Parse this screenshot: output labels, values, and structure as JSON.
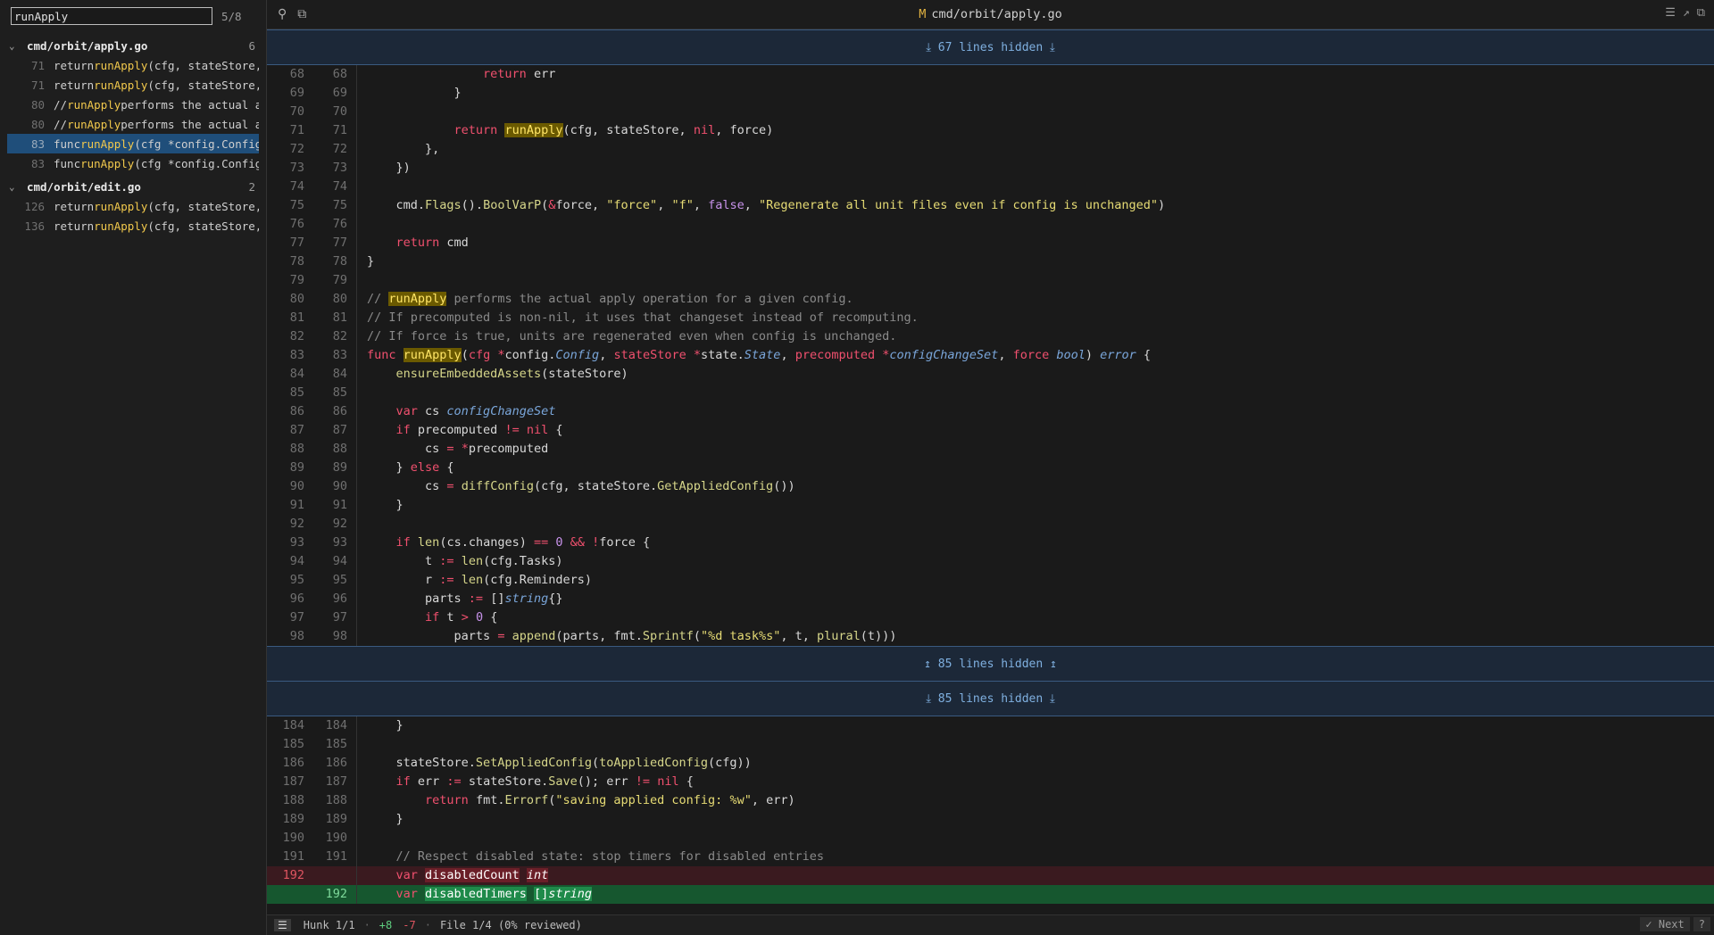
{
  "search": {
    "value": "runApply",
    "match_count": "5/8"
  },
  "results": [
    {
      "file": "cmd/orbit/apply.go",
      "count": "6",
      "matches": [
        {
          "line": "71",
          "pre": "return ",
          "hl": "runApply",
          "post": "(cfg, stateStore, ni",
          "selected": false
        },
        {
          "line": "71",
          "pre": "return ",
          "hl": "runApply",
          "post": "(cfg, stateStore, ni",
          "selected": false
        },
        {
          "line": "80",
          "pre": "// ",
          "hl": "runApply",
          "post": " performs the actual app",
          "selected": false
        },
        {
          "line": "80",
          "pre": "// ",
          "hl": "runApply",
          "post": " performs the actual app",
          "selected": false
        },
        {
          "line": "83",
          "pre": "func ",
          "hl": "runApply",
          "post": "(cfg *config.Config, s",
          "selected": true
        },
        {
          "line": "83",
          "pre": "func ",
          "hl": "runApply",
          "post": "(cfg *config.Config, s",
          "selected": false
        }
      ]
    },
    {
      "file": "cmd/orbit/edit.go",
      "count": "2",
      "matches": [
        {
          "line": "126",
          "pre": "return ",
          "hl": "runApply",
          "post": "(cfg, stateStore, &c",
          "selected": false
        },
        {
          "line": "136",
          "pre": "return ",
          "hl": "runApply",
          "post": "(cfg, stateStore, &c",
          "selected": false
        }
      ]
    }
  ],
  "topbar": {
    "status_mark": "M",
    "file_title": "cmd/orbit/apply.go"
  },
  "hidden": {
    "top": "⤓ 67 lines hidden ⤓",
    "mid_up": "↥ 85 lines hidden ↥",
    "mid_down": "⤓ 85 lines hidden ⤓"
  },
  "code_top": [
    {
      "o": "68",
      "n": "68",
      "html": "            <span class='k'>return</span> err"
    },
    {
      "o": "69",
      "n": "69",
      "html": "        }"
    },
    {
      "o": "70",
      "n": "70",
      "html": ""
    },
    {
      "o": "71",
      "n": "71",
      "html": "        <span class='k'>return</span> <span class='hlw'>runApply</span>(cfg, stateStore, <span class='k'>nil</span>, force)"
    },
    {
      "o": "72",
      "n": "72",
      "html": "    },"
    },
    {
      "o": "73",
      "n": "73",
      "html": "})"
    },
    {
      "o": "74",
      "n": "74",
      "html": ""
    },
    {
      "o": "75",
      "n": "75",
      "html": "cmd.<span class='f'>Flags</span>().<span class='f'>BoolVarP</span>(<span class='pu'>&amp;</span>force, <span class='s'>\"force\"</span>, <span class='s'>\"f\"</span>, <span class='nm'>false</span>, <span class='s'>\"Regenerate all unit files even if config is unchanged\"</span>)"
    },
    {
      "o": "76",
      "n": "76",
      "html": ""
    },
    {
      "o": "77",
      "n": "77",
      "html": "<span class='k'>return</span> cmd"
    },
    {
      "o": "78",
      "n": "78",
      "html": "}",
      "outdent": true
    },
    {
      "o": "79",
      "n": "79",
      "html": ""
    },
    {
      "o": "80",
      "n": "80",
      "html": "<span class='c'>// </span><span class='hlw'>runApply</span><span class='c'> performs the actual apply operation for a given config.</span>",
      "outdent": true
    },
    {
      "o": "81",
      "n": "81",
      "html": "<span class='c'>// If precomputed is non-nil, it uses that changeset instead of recomputing.</span>",
      "outdent": true
    },
    {
      "o": "82",
      "n": "82",
      "html": "<span class='c'>// If force is true, units are regenerated even when config is unchanged.</span>",
      "outdent": true
    },
    {
      "o": "83",
      "n": "83",
      "html": "<span class='k'>func</span> <span class='hlw'>runApply</span>(<span class='k'>cfg</span> <span class='pu'>*</span>config.<span class='ty'>Config</span>, <span class='k'>stateStore</span> <span class='pu'>*</span>state.<span class='ty'>State</span>, <span class='k'>precomputed</span> <span class='pu'>*</span><span class='ty'>configChangeSet</span>, <span class='k'>force</span> <span class='ty'>bool</span>) <span class='ty'>error</span> {",
      "outdent": true
    },
    {
      "o": "84",
      "n": "84",
      "html": "<span class='f'>ensureEmbeddedAssets</span>(stateStore)"
    },
    {
      "o": "85",
      "n": "85",
      "html": ""
    },
    {
      "o": "86",
      "n": "86",
      "html": "<span class='k'>var</span> cs <span class='ty'>configChangeSet</span>"
    },
    {
      "o": "87",
      "n": "87",
      "html": "<span class='k'>if</span> precomputed <span class='pu'>!=</span> <span class='k'>nil</span> {"
    },
    {
      "o": "88",
      "n": "88",
      "html": "    cs <span class='pu'>=</span> <span class='pu'>*</span>precomputed"
    },
    {
      "o": "89",
      "n": "89",
      "html": "} <span class='k'>else</span> {"
    },
    {
      "o": "90",
      "n": "90",
      "html": "    cs <span class='pu'>=</span> <span class='f'>diffConfig</span>(cfg, stateStore.<span class='f'>GetAppliedConfig</span>())"
    },
    {
      "o": "91",
      "n": "91",
      "html": "}"
    },
    {
      "o": "92",
      "n": "92",
      "html": ""
    },
    {
      "o": "93",
      "n": "93",
      "html": "<span class='k'>if</span> <span class='f'>len</span>(cs.changes) <span class='pu'>==</span> <span class='nm'>0</span> <span class='pu'>&amp;&amp;</span> <span class='pu'>!</span>force {"
    },
    {
      "o": "94",
      "n": "94",
      "html": "    t <span class='pu'>:=</span> <span class='f'>len</span>(cfg.Tasks)"
    },
    {
      "o": "95",
      "n": "95",
      "html": "    r <span class='pu'>:=</span> <span class='f'>len</span>(cfg.Reminders)"
    },
    {
      "o": "96",
      "n": "96",
      "html": "    parts <span class='pu'>:=</span> []<span class='ty'>string</span>{}"
    },
    {
      "o": "97",
      "n": "97",
      "html": "    <span class='k'>if</span> t <span class='pu'>&gt;</span> <span class='nm'>0</span> {"
    },
    {
      "o": "98",
      "n": "98",
      "html": "        parts <span class='pu'>=</span> <span class='f'>append</span>(parts, fmt.<span class='f'>Sprintf</span>(<span class='s'>\"%d task%s\"</span>, t, <span class='f'>plural</span>(t)))"
    }
  ],
  "code_bottom": [
    {
      "o": "184",
      "n": "184",
      "html": "}"
    },
    {
      "o": "185",
      "n": "185",
      "html": ""
    },
    {
      "o": "186",
      "n": "186",
      "html": "stateStore.<span class='f'>SetAppliedConfig</span>(<span class='f'>toAppliedConfig</span>(cfg))"
    },
    {
      "o": "187",
      "n": "187",
      "html": "<span class='k'>if</span> err <span class='pu'>:=</span> stateStore.<span class='f'>Save</span>(); err <span class='pu'>!=</span> <span class='k'>nil</span> {"
    },
    {
      "o": "188",
      "n": "188",
      "html": "    <span class='k'>return</span> fmt.<span class='f'>Errorf</span>(<span class='s'>\"saving applied config: %w\"</span>, err)"
    },
    {
      "o": "189",
      "n": "189",
      "html": "}"
    },
    {
      "o": "190",
      "n": "190",
      "html": ""
    },
    {
      "o": "191",
      "n": "191",
      "html": "<span class='c'>// Respect disabled state: stop timers for disabled entries</span>"
    },
    {
      "o": "192",
      "n": "",
      "kind": "del",
      "html": "<span class='k'>var</span> <span class='dc'>disabledCount</span> <span class='dc ty'>int</span>"
    },
    {
      "o": "",
      "n": "192",
      "kind": "add",
      "html": "<span class='k'>var</span> <span class='ac'>disabledTimers</span> <span class='ac'>[]<span style='font-style:italic'>string</span></span>"
    }
  ],
  "status": {
    "hunk": "Hunk 1/1",
    "added": "+8",
    "removed": "-7",
    "file": "File 1/4 (0% reviewed)",
    "next": "✓ Next",
    "help": "?"
  },
  "colors": {
    "accent": "#1f4e7a",
    "highlight": "#6b5a00",
    "added": "#16572f",
    "deleted": "#3a1a1f"
  }
}
